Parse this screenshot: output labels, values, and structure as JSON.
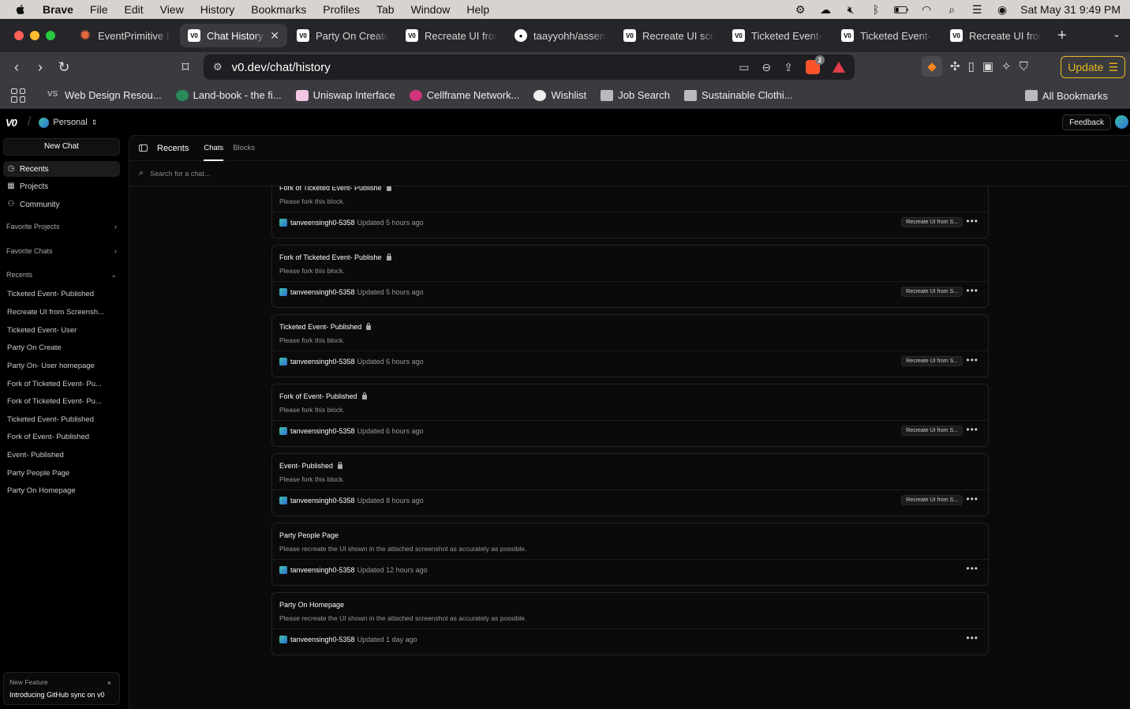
{
  "menubar": {
    "app": "Brave",
    "items": [
      "File",
      "Edit",
      "View",
      "History",
      "Bookmarks",
      "Profiles",
      "Tab",
      "Window",
      "Help"
    ],
    "clock": "Sat May 31  9:49 PM"
  },
  "tabs": [
    {
      "label": "EventPrimitive P",
      "icon": "sparkle-icon"
    },
    {
      "label": "Chat History",
      "icon": "v0-icon",
      "active": true
    },
    {
      "label": "Party On Create",
      "icon": "v0-icon"
    },
    {
      "label": "Recreate UI fron",
      "icon": "v0-icon"
    },
    {
      "label": "taayyohh/assem",
      "icon": "github-icon"
    },
    {
      "label": "Recreate UI scre",
      "icon": "v0-icon"
    },
    {
      "label": "Ticketed Event-",
      "icon": "v0-icon"
    },
    {
      "label": "Ticketed Event-",
      "icon": "v0-icon"
    },
    {
      "label": "Recreate UI fror",
      "icon": "v0-icon"
    }
  ],
  "toolbar": {
    "url": "v0.dev/chat/history",
    "brave_count": "2",
    "update_label": "Update"
  },
  "bookmarks": {
    "items": [
      "Web Design Resou...",
      "Land-book - the fi...",
      "Uniswap Interface",
      "Cellframe Network...",
      "Wishlist",
      "Job Search",
      "Sustainable Clothi..."
    ],
    "all_label": "All Bookmarks"
  },
  "app": {
    "logo": "V0",
    "workspace": "Personal",
    "feedback_label": "Feedback"
  },
  "sidebar": {
    "new_chat": "New Chat",
    "nav": [
      "Recents",
      "Projects",
      "Community"
    ],
    "favorite_projects": "Favorite Projects",
    "favorite_chats": "Favorite Chats",
    "recents_label": "Recents",
    "recents": [
      "Ticketed Event- Published",
      "Recreate UI from Screensh...",
      "Ticketed Event- User",
      "Party On Create",
      "Party On- User homepage",
      "Fork of Ticketed Event- Pu...",
      "Fork of Ticketed Event- Pu...",
      "Ticketed Event- Published",
      "Fork of Event- Published",
      "Event- Published",
      "Party People Page",
      "Party On Homepage"
    ],
    "promo": {
      "title": "New Feature",
      "desc": "Introducing GitHub sync on v0",
      "close": "×"
    }
  },
  "main": {
    "title": "Recents",
    "tabs": [
      "Chats",
      "Blocks"
    ],
    "search_placeholder": "Search for a chat...",
    "chats": [
      {
        "title": "Fork of Ticketed Event- Publishe",
        "locked": true,
        "desc": "Please fork this block.",
        "user": "tanveensingh0-5358",
        "updated": "Updated 5 hours ago",
        "badge": "Recreate UI from S..."
      },
      {
        "title": "Fork of Ticketed Event- Publishe",
        "locked": true,
        "desc": "Please fork this block.",
        "user": "tanveensingh0-5358",
        "updated": "Updated 5 hours ago",
        "badge": "Recreate UI from S..."
      },
      {
        "title": "Ticketed Event- Published",
        "locked": true,
        "desc": "Please fork this block.",
        "user": "tanveensingh0-5358",
        "updated": "Updated 6 hours ago",
        "badge": "Recreate UI from S..."
      },
      {
        "title": "Fork of Event- Published",
        "locked": true,
        "desc": "Please fork this block.",
        "user": "tanveensingh0-5358",
        "updated": "Updated 6 hours ago",
        "badge": "Recreate UI from S..."
      },
      {
        "title": "Event- Published",
        "locked": true,
        "desc": "Please fork this block.",
        "user": "tanveensingh0-5358",
        "updated": "Updated 8 hours ago",
        "badge": "Recreate UI from S..."
      },
      {
        "title": "Party People Page",
        "locked": false,
        "desc": "Please recreate the UI shown in the attached screenshot as accurately as possible.",
        "user": "tanveensingh0-5358",
        "updated": "Updated 12 hours ago",
        "badge": ""
      },
      {
        "title": "Party On Homepage",
        "locked": false,
        "desc": "Please recreate the UI shown in the attached screenshot as accurately as possible.",
        "user": "tanveensingh0-5358",
        "updated": "Updated 1 day ago",
        "badge": ""
      }
    ]
  }
}
